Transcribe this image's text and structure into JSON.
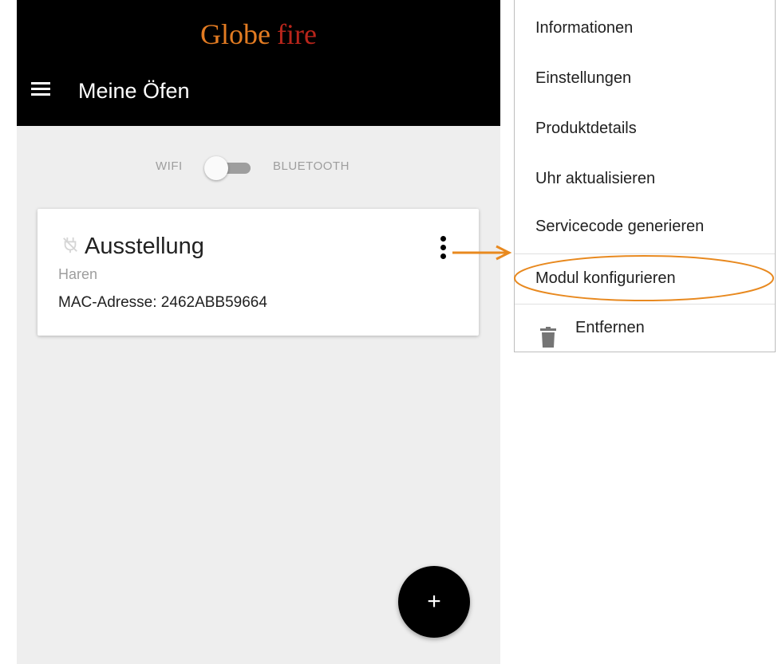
{
  "header": {
    "brand_part1": "Globe",
    "brand_part2": "fire",
    "title": "Meine Öfen"
  },
  "connection_toggle": {
    "left_label": "WIFI",
    "right_label": "BLUETOOTH"
  },
  "stove": {
    "name": "Ausstellung",
    "location": "Haren",
    "mac_label": "MAC-Adresse: 2462ABB59664"
  },
  "fab": {
    "label": "+"
  },
  "context_menu": {
    "items": [
      {
        "label": "Informationen"
      },
      {
        "label": "Einstellungen"
      },
      {
        "label": "Produktdetails"
      },
      {
        "label": "Uhr aktualisieren"
      },
      {
        "label": "Servicecode generieren"
      },
      {
        "label": "Modul konfigurieren"
      },
      {
        "label": "Entfernen"
      }
    ]
  },
  "colors": {
    "header_bg": "#000000",
    "brand_orange": "#e27b22",
    "brand_red": "#b8251b",
    "annotation_orange": "#e8891f",
    "screen_bg": "#eeeeee"
  },
  "icons": {
    "menu": "hamburger-icon",
    "disconnected": "plug-off-icon",
    "more": "more-vert-icon",
    "delete": "trash-icon"
  }
}
